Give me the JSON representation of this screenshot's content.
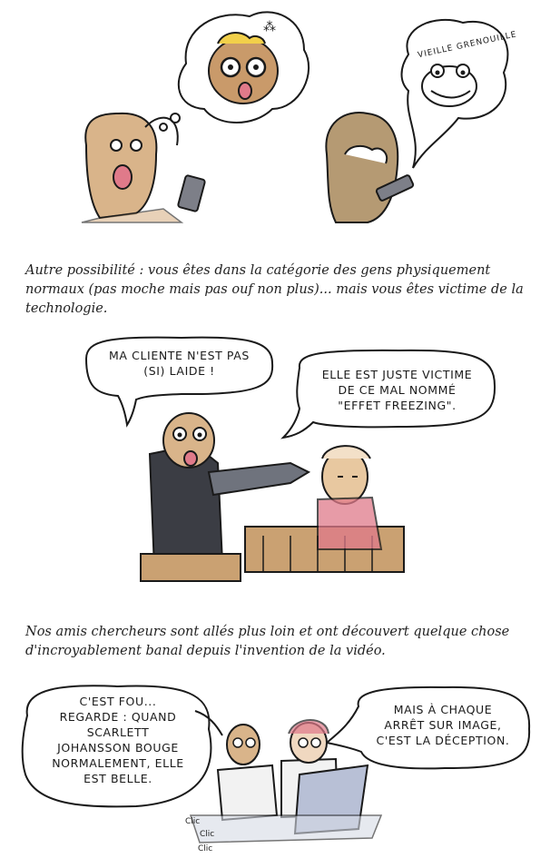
{
  "panel1": {
    "frog_label": "VIEILLE GRENOUILLE"
  },
  "captions": {
    "first": "Autre possibilité : vous êtes dans la catégorie des gens physiquement normaux (pas moche mais pas ouf non plus)... mais vous êtes victime de la technologie.",
    "second": "Nos amis chercheurs sont allés plus loin et ont découvert quelque chose d'incroyablement banal depuis l'invention de la vidéo."
  },
  "panel2": {
    "lawyer_line1": "MA CLIENTE N'EST PAS",
    "lawyer_line2": "(SI) LAIDE !",
    "lawyer2_line1": "ELLE EST JUSTE VICTIME",
    "lawyer2_line2": "DE CE MAL NOMMÉ",
    "lawyer2_line3": "\"EFFET FREEZING\"."
  },
  "panel3": {
    "left_line1": "C'EST FOU...",
    "left_line2": "REGARDE : QUAND",
    "left_line3": "SCARLETT",
    "left_line4": "JOHANSSON BOUGE",
    "left_line5": "NORMALEMENT, ELLE",
    "left_line6": "EST BELLE.",
    "right_line1": "MAIS À CHAQUE",
    "right_line2": "ARRÊT SUR IMAGE,",
    "right_line3": "C'EST LA DÉCEPTION.",
    "click1": "Clic",
    "click2": "Clic",
    "click3": "Clic"
  },
  "colors": {
    "skin": "#d9b48a",
    "skin_shadow": "#b8895a",
    "grey_suit": "#6f737d",
    "dark_suit": "#3b3d44",
    "wood": "#caa172",
    "pink": "#e07a8a",
    "screen_blue": "#b8c0d6"
  }
}
